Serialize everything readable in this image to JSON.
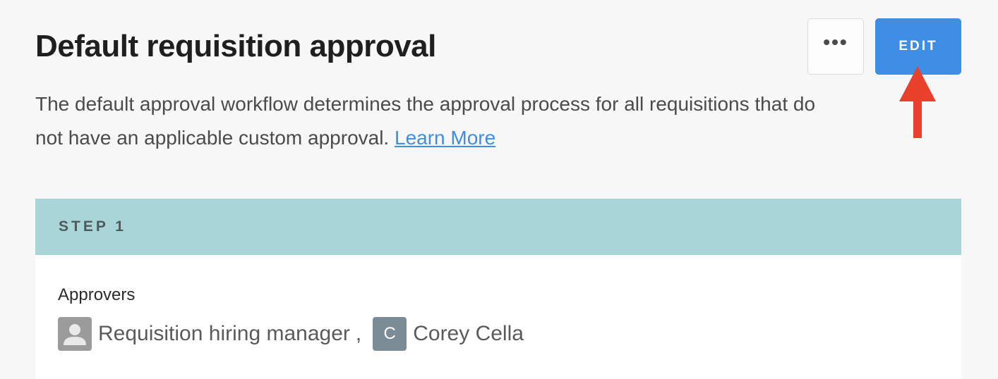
{
  "header": {
    "title": "Default requisition approval",
    "more_label": "•••",
    "edit_label": "EDIT"
  },
  "description": {
    "text": "The default approval workflow determines the approval process for all requisitions that do not have an applicable custom approval. ",
    "link_label": "Learn More"
  },
  "annotation": {
    "arrow_color": "#e8402a"
  },
  "step": {
    "label": "STEP 1",
    "approvers_label": "Approvers",
    "approvers": [
      {
        "name": "Requisition hiring manager",
        "avatar_icon": "generic-user-icon",
        "separator": ","
      },
      {
        "name": "Corey Cella",
        "avatar_initial": "C"
      }
    ]
  },
  "colors": {
    "accent": "#3e8ee6",
    "step_header": "#aad5d8",
    "background": "#f7f7f7"
  }
}
